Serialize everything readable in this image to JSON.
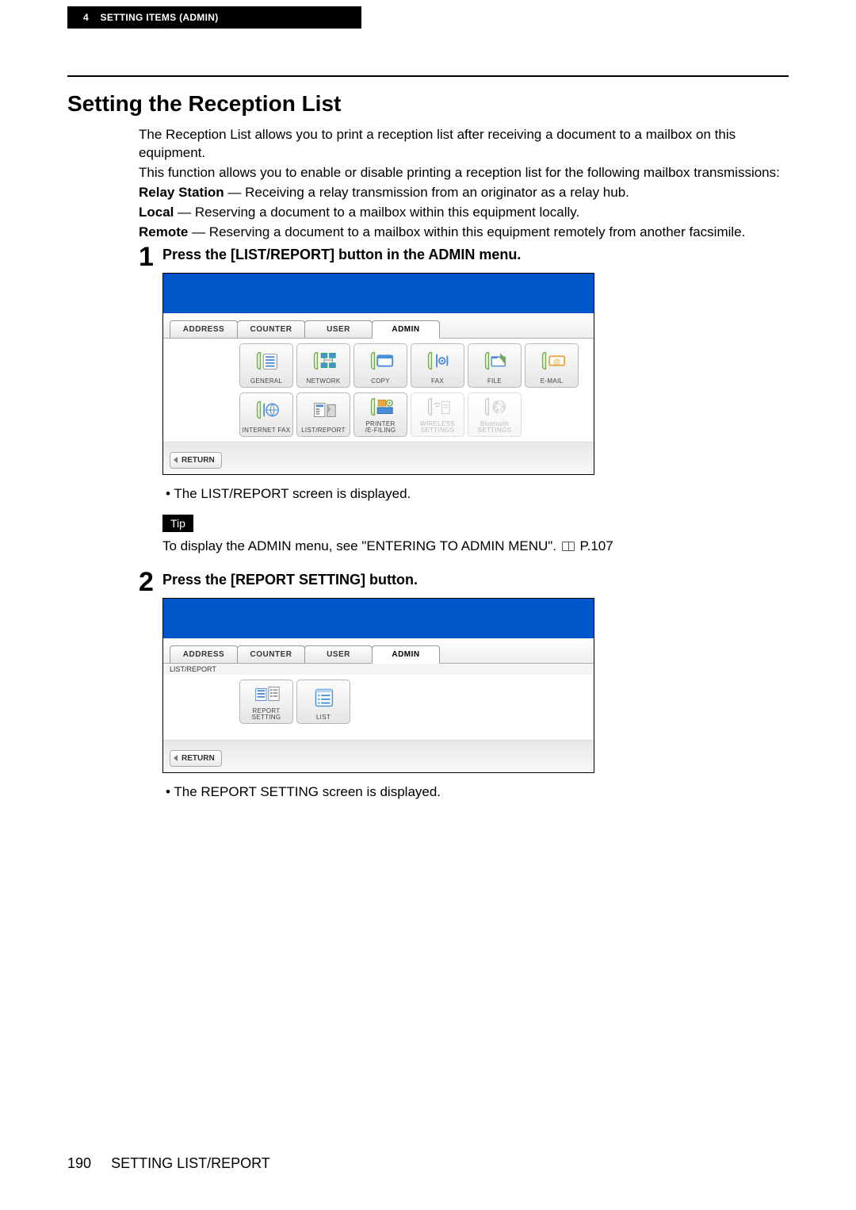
{
  "header": {
    "chapter": "4",
    "chapter_label": "SETTING ITEMS (ADMIN)"
  },
  "title": "Setting the Reception List",
  "intro": {
    "p1": "The Reception List allows you to print a reception list after receiving a document to a mailbox on this equipment.",
    "p2": "This function allows you to enable or disable printing a reception list for the following mailbox transmissions:",
    "relay_label": "Relay Station",
    "relay_text": " — Receiving a relay transmission from an originator as a relay hub.",
    "local_label": "Local",
    "local_text": " — Reserving a document to a mailbox within this equipment locally.",
    "remote_label": "Remote",
    "remote_text": " — Reserving a document to a mailbox within this equipment remotely from another facsimile."
  },
  "step1": {
    "num": "1",
    "title": "Press the [LIST/REPORT] button in the ADMIN menu.",
    "bullet": "The LIST/REPORT screen is displayed.",
    "tip_label": "Tip",
    "tip_text_a": "To display the ADMIN menu, see \"ENTERING TO ADMIN MENU\". ",
    "tip_text_b": " P.107"
  },
  "step2": {
    "num": "2",
    "title": "Press the [REPORT SETTING] button.",
    "bullet": "The REPORT SETTING screen is displayed."
  },
  "screen_common": {
    "tab_address": "ADDRESS",
    "tab_counter": "COUNTER",
    "tab_user": "USER",
    "tab_admin": "ADMIN",
    "return": "RETURN"
  },
  "screen1": {
    "btn_general": "GENERAL",
    "btn_network": "NETWORK",
    "btn_copy": "COPY",
    "btn_fax": "FAX",
    "btn_file": "FILE",
    "btn_email": "E-MAIL",
    "btn_internet_fax": "INTERNET FAX",
    "btn_list_report": "LIST/REPORT",
    "btn_printer_efiling_l1": "PRINTER",
    "btn_printer_efiling_l2": "/E-FILING",
    "btn_wireless_l1": "WIRELESS",
    "btn_wireless_l2": "SETTINGS",
    "btn_bluetooth_l1": "Bluetooth",
    "btn_bluetooth_l2": "SETTINGS"
  },
  "screen2": {
    "breadcrumb": "LIST/REPORT",
    "btn_report_setting": "REPORT SETTING",
    "btn_list": "LIST"
  },
  "footer": {
    "page": "190",
    "section": "SETTING LIST/REPORT"
  }
}
